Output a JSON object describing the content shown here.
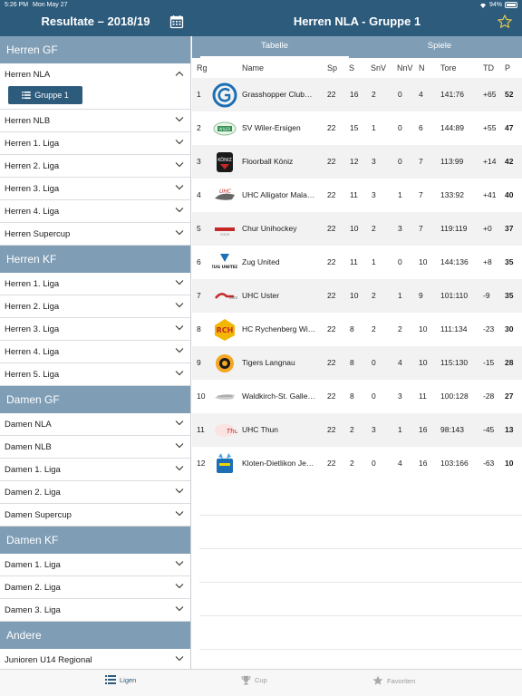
{
  "status": {
    "time": "5:26 PM",
    "date": "Mon May 27",
    "battery": "94%"
  },
  "left_title": "Resultate – 2018/19",
  "right_title": "Herren NLA - Gruppe 1",
  "sidebar": {
    "sections": [
      {
        "title": "Herren GF",
        "items": [
          {
            "label": "Herren NLA",
            "expanded": true,
            "group_button": "Gruppe 1"
          },
          {
            "label": "Herren NLB"
          },
          {
            "label": "Herren 1. Liga"
          },
          {
            "label": "Herren 2. Liga"
          },
          {
            "label": "Herren 3. Liga"
          },
          {
            "label": "Herren 4. Liga"
          },
          {
            "label": "Herren Supercup"
          }
        ]
      },
      {
        "title": "Herren KF",
        "items": [
          {
            "label": "Herren 1. Liga"
          },
          {
            "label": "Herren 2. Liga"
          },
          {
            "label": "Herren 3. Liga"
          },
          {
            "label": "Herren 4. Liga"
          },
          {
            "label": "Herren 5. Liga"
          }
        ]
      },
      {
        "title": "Damen GF",
        "items": [
          {
            "label": "Damen NLA"
          },
          {
            "label": "Damen NLB"
          },
          {
            "label": "Damen 1. Liga"
          },
          {
            "label": "Damen 2. Liga"
          },
          {
            "label": "Damen Supercup"
          }
        ]
      },
      {
        "title": "Damen KF",
        "items": [
          {
            "label": "Damen 1. Liga"
          },
          {
            "label": "Damen 2. Liga"
          },
          {
            "label": "Damen 3. Liga"
          }
        ]
      },
      {
        "title": "Andere",
        "items": [
          {
            "label": "Junioren U14 Regional"
          }
        ]
      }
    ]
  },
  "tabs": [
    {
      "label": "Tabelle",
      "active": true
    },
    {
      "label": "Spiele",
      "active": false
    }
  ],
  "table": {
    "headers": {
      "rank": "Rg",
      "name": "Name",
      "sp": "Sp",
      "s": "S",
      "snv": "SnV",
      "nnv": "NnV",
      "n": "N",
      "tore": "Tore",
      "td": "TD",
      "p": "P"
    },
    "rows": [
      {
        "rank": "1",
        "name": "Grasshopper Club…",
        "sp": "22",
        "s": "16",
        "snv": "2",
        "nnv": "0",
        "n": "4",
        "tore": "141:76",
        "td": "+65",
        "p": "52",
        "logo": "gc-logo-icon"
      },
      {
        "rank": "2",
        "name": "SV Wiler-Ersigen",
        "sp": "22",
        "s": "15",
        "snv": "1",
        "nnv": "0",
        "n": "6",
        "tore": "144:89",
        "td": "+55",
        "p": "47",
        "logo": "wiler-logo-icon"
      },
      {
        "rank": "3",
        "name": "Floorball Köniz",
        "sp": "22",
        "s": "12",
        "snv": "3",
        "nnv": "0",
        "n": "7",
        "tore": "113:99",
        "td": "+14",
        "p": "42",
        "logo": "koniz-logo-icon"
      },
      {
        "rank": "4",
        "name": "UHC Alligator Mala…",
        "sp": "22",
        "s": "11",
        "snv": "3",
        "nnv": "1",
        "n": "7",
        "tore": "133:92",
        "td": "+41",
        "p": "40",
        "logo": "alligator-logo-icon"
      },
      {
        "rank": "5",
        "name": "Chur Unihockey",
        "sp": "22",
        "s": "10",
        "snv": "2",
        "nnv": "3",
        "n": "7",
        "tore": "119:119",
        "td": "+0",
        "p": "37",
        "logo": "chur-logo-icon"
      },
      {
        "rank": "6",
        "name": "Zug United",
        "sp": "22",
        "s": "11",
        "snv": "1",
        "nnv": "0",
        "n": "10",
        "tore": "144:136",
        "td": "+8",
        "p": "35",
        "logo": "zug-logo-icon"
      },
      {
        "rank": "7",
        "name": "UHC Uster",
        "sp": "22",
        "s": "10",
        "snv": "2",
        "nnv": "1",
        "n": "9",
        "tore": "101:110",
        "td": "-9",
        "p": "35",
        "logo": "uster-logo-icon"
      },
      {
        "rank": "8",
        "name": "HC Rychenberg Wi…",
        "sp": "22",
        "s": "8",
        "snv": "2",
        "nnv": "2",
        "n": "10",
        "tore": "111:134",
        "td": "-23",
        "p": "30",
        "logo": "rychenberg-logo-icon"
      },
      {
        "rank": "9",
        "name": "Tigers Langnau",
        "sp": "22",
        "s": "8",
        "snv": "0",
        "nnv": "4",
        "n": "10",
        "tore": "115:130",
        "td": "-15",
        "p": "28",
        "logo": "tigers-logo-icon"
      },
      {
        "rank": "10",
        "name": "Waldkirch-St. Galle…",
        "sp": "22",
        "s": "8",
        "snv": "0",
        "nnv": "3",
        "n": "11",
        "tore": "100:128",
        "td": "-28",
        "p": "27",
        "logo": "waldkirch-logo-icon"
      },
      {
        "rank": "11",
        "name": "UHC Thun",
        "sp": "22",
        "s": "2",
        "snv": "3",
        "nnv": "1",
        "n": "16",
        "tore": "98:143",
        "td": "-45",
        "p": "13",
        "logo": "thun-logo-icon"
      },
      {
        "rank": "12",
        "name": "Kloten-Dietlikon Je…",
        "sp": "22",
        "s": "2",
        "snv": "0",
        "nnv": "4",
        "n": "16",
        "tore": "103:166",
        "td": "-63",
        "p": "10",
        "logo": "kloten-logo-icon"
      }
    ]
  },
  "tabbar": [
    {
      "label": "Ligen",
      "icon": "list-icon",
      "active": true
    },
    {
      "label": "Cup",
      "icon": "trophy-icon",
      "active": false
    },
    {
      "label": "Favoriten",
      "icon": "star-icon",
      "active": false
    }
  ],
  "colors": {
    "nav": "#2d5b7c",
    "section": "#7f9db5",
    "stripe": "#f2f2f2"
  }
}
